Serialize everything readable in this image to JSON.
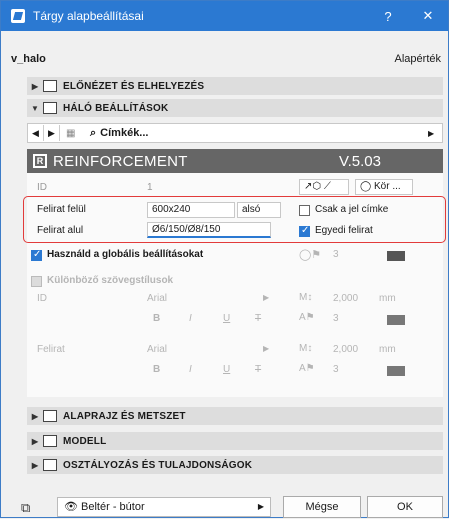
{
  "window": {
    "title": "Tárgy alapbeállításai",
    "help": "?",
    "close": "✕"
  },
  "header": {
    "object_name": "v_halo",
    "default_label": "Alapérték"
  },
  "sections": {
    "preview": "ELŐNÉZET ÉS ELHELYEZÉS",
    "mesh": "HÁLÓ BEÁLLÍTÁSOK",
    "floorplan": "ALAPRAJZ ÉS METSZET",
    "model": "MODELL",
    "classification": "OSZTÁLYOZÁS ÉS TULAJDONSÁGOK"
  },
  "toolbar": {
    "label": "Címkék..."
  },
  "banner": {
    "title": "REINFORCEMENT",
    "version": "V.5.03"
  },
  "params": {
    "id_label": "ID",
    "id_value": "1",
    "shape_label": "Kör ...",
    "top_label": "Felirat felül",
    "top_value": "600x240",
    "top_pos": "alsó",
    "only_label": "Csak a jel címke",
    "bottom_label": "Felirat alul",
    "bottom_value": "Ø6/150/Ø8/150",
    "custom_label": "Egyedi felirat",
    "global_label": "Használd a globális beállításokat",
    "global_num": "3",
    "diff_styles_label": "Különböző szövegstílusok",
    "id2_label": "ID",
    "font1": "Arial",
    "size1": "2,000",
    "unit1": "mm",
    "pen1": "3",
    "felirat_label": "Felirat",
    "font2": "Arial",
    "size2": "2,000",
    "unit2": "mm",
    "pen2": "3"
  },
  "footer": {
    "layer": "Beltér - bútor",
    "cancel": "Mégse",
    "ok": "OK"
  }
}
